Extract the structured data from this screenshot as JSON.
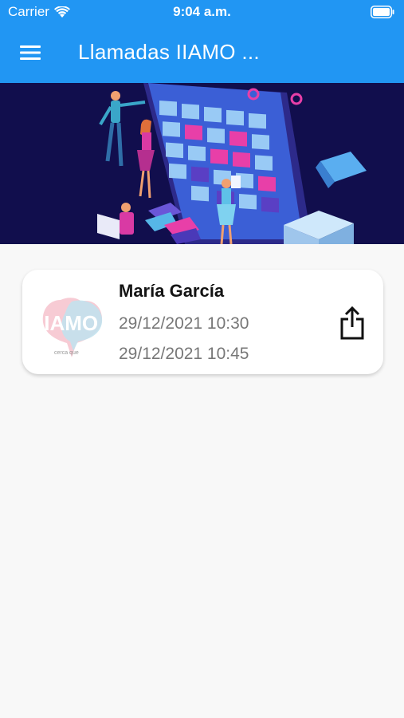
{
  "status_bar": {
    "carrier": "Carrier",
    "time": "9:04 a.m.",
    "icons": [
      "wifi-icon",
      "battery-icon"
    ]
  },
  "app_bar": {
    "title": "Llamadas IIAMO ...",
    "menu_icon": "hamburger-menu-icon",
    "color": "#2196f3"
  },
  "banner": {
    "description_icon": "calendar-illustration",
    "background": "#110e4d"
  },
  "calls": [
    {
      "name": "María García",
      "start": "29/12/2021 10:30",
      "end": "29/12/2021 10:45",
      "logo_text": "IIAMO",
      "logo_tagline": "cerca que",
      "action_icon": "share-icon"
    }
  ]
}
